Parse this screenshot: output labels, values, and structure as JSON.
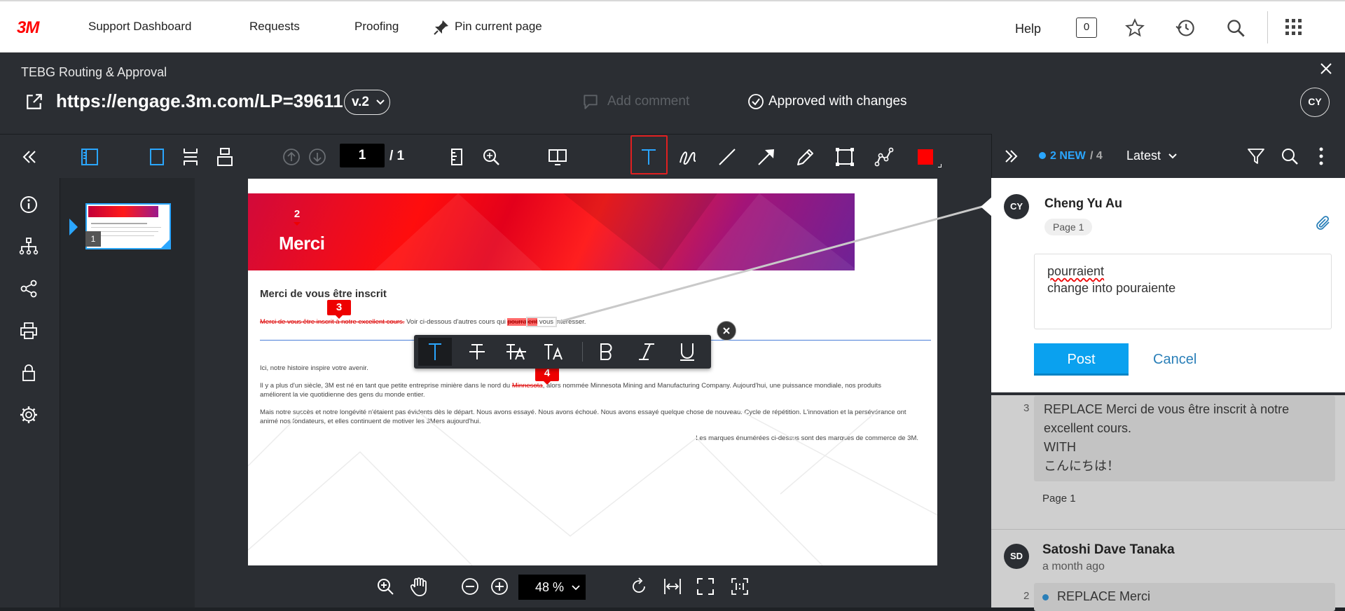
{
  "topnav": {
    "logo": "3M",
    "items": [
      "Support Dashboard",
      "Requests",
      "Proofing"
    ],
    "pin_label": "Pin current page",
    "help": "Help",
    "badge_count": "0"
  },
  "header": {
    "subtitle": "TEBG Routing & Approval",
    "url": "https://engage.3m.com/LP=39611",
    "version": "v.2",
    "add_comment": "Add comment",
    "status": "Approved with changes",
    "user_initials": "CY"
  },
  "toolbar": {
    "page_current": "1",
    "page_total": "/ 1",
    "color_accent": "#ff0000"
  },
  "thumbnails": {
    "page_number": "1"
  },
  "document": {
    "banner_title": "Merci",
    "markers": [
      "2",
      "3",
      "4"
    ],
    "heading": "Merci de vous être inscrit",
    "line1_struck": "Merci de vous être inscrit à notre excellent cours.",
    "line1_rest": " Voir ci-dessous d'autres cours qui ",
    "line1_hl": "pourraient",
    "line1_end": " vous intéresser.",
    "para1": "Ici, notre histoire inspire votre avenir.",
    "para2a": "Il y a plus d'un siècle, 3M est né en tant que petite entreprise minière dans le nord du ",
    "para2_struck": "Minnesota",
    "para2b": ", alors nommée Minnesota Mining and Manufacturing Company. Aujourd'hui, une puissance mondiale, nos produits améliorent la vie quotidienne des gens du monde entier.",
    "para3": "Mais notre succès et notre longévité n'étaient pas évidents dès le départ. Nous avons essayé. Nous avons échoué. Nous avons essayé quelque chose de nouveau. Cycle de répétition. L'innovation et la persévérance ont animé nos fondateurs, et elles continuent de motiver les 3Mers aujourd'hui.",
    "trademark": "Les marques énumérées ci-dessus sont des marques de commerce de 3M."
  },
  "bottombar": {
    "zoom": "48 %"
  },
  "panel": {
    "new_count": "2 NEW",
    "total": " / 4",
    "sort": "Latest",
    "active_comment": {
      "initials": "CY",
      "author": "Cheng Yu Au",
      "page": "Page 1",
      "text_line1": "pourraient",
      "text_line2": "change into pouraiente",
      "post": "Post",
      "cancel": "Cancel"
    },
    "item3": {
      "number": "3",
      "text": "REPLACE Merci de vous être inscrit à notre excellent cours.",
      "with": "WITH",
      "replacement": "こんにちは！",
      "page": "Page 1"
    },
    "item_sd": {
      "initials": "SD",
      "author": "Satoshi Dave Tanaka",
      "time": "a month ago",
      "number": "2",
      "text": "REPLACE Merci"
    }
  }
}
